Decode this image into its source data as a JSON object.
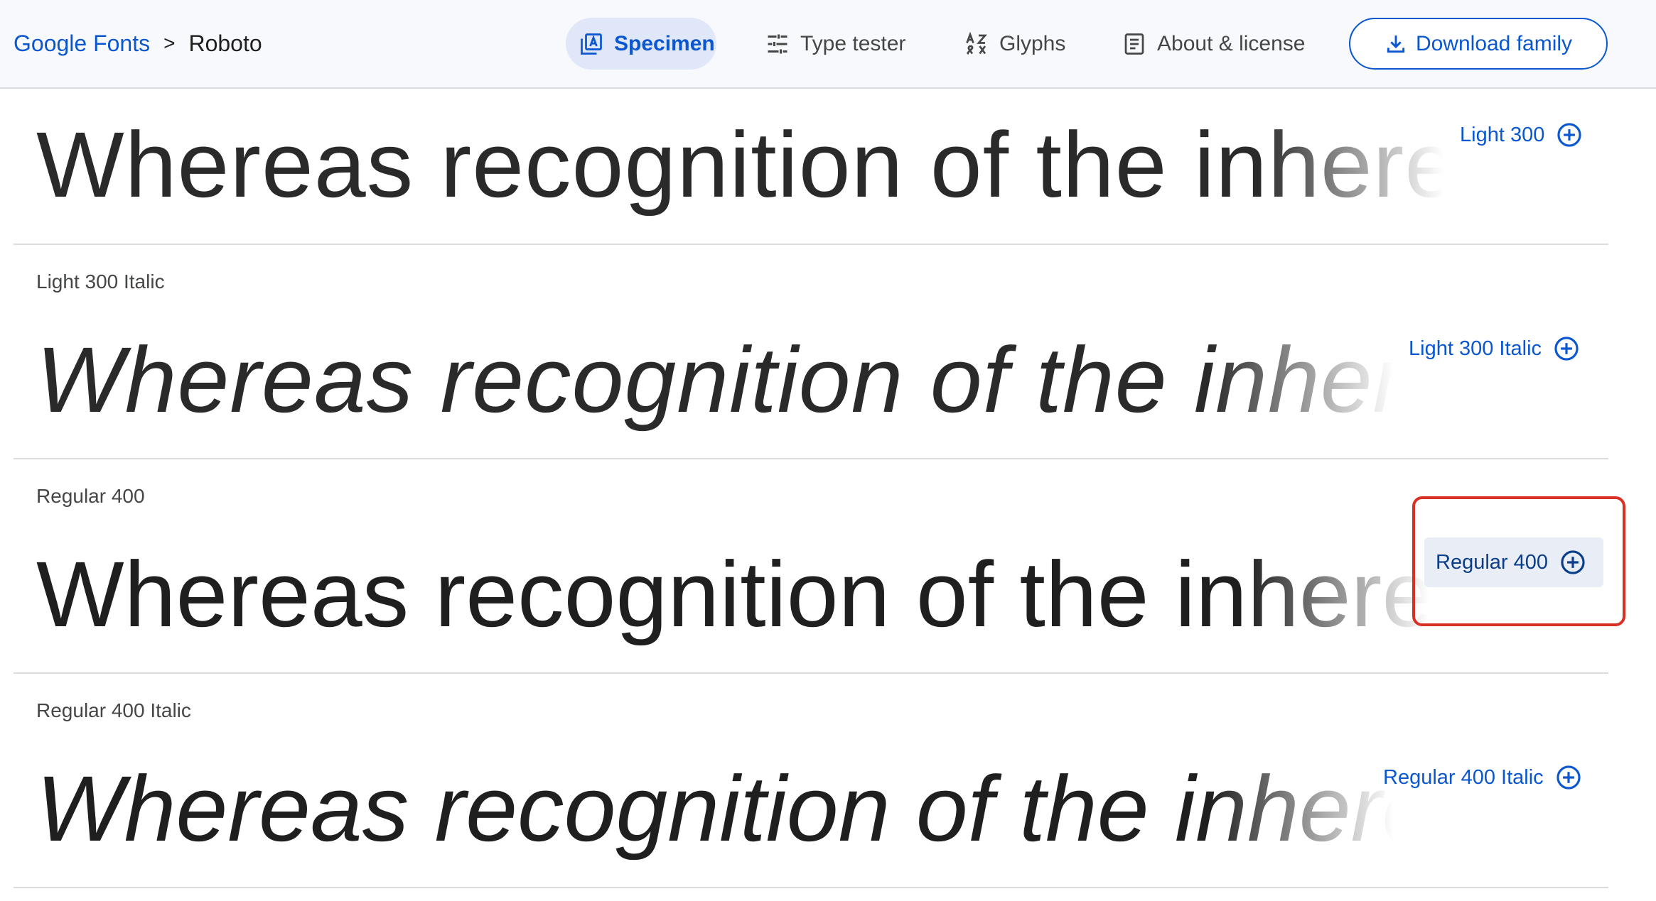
{
  "header": {
    "breadcrumb": {
      "root": "Google Fonts",
      "separator": ">",
      "current": "Roboto"
    },
    "tabs": [
      {
        "label": "Specimen",
        "icon": "specimen-icon",
        "active": true
      },
      {
        "label": "Type tester",
        "icon": "sliders-icon",
        "active": false
      },
      {
        "label": "Glyphs",
        "icon": "glyphs-icon",
        "active": false
      },
      {
        "label": "About & license",
        "icon": "article-icon",
        "active": false
      }
    ],
    "download_label": "Download family"
  },
  "sample_text": "Whereas recognition of the inherent dignity",
  "styles": [
    {
      "label": "",
      "button": "Light 300"
    },
    {
      "label": "Light 300 Italic",
      "button": "Light 300 Italic"
    },
    {
      "label": "Regular 400",
      "button": "Regular 400"
    },
    {
      "label": "Regular 400 Italic",
      "button": "Regular 400 Italic"
    }
  ],
  "colors": {
    "accent": "#0b57d0",
    "header_bg": "#f8f9fc",
    "active_tab_bg": "#dfe7f8",
    "highlight": "#d93025"
  }
}
